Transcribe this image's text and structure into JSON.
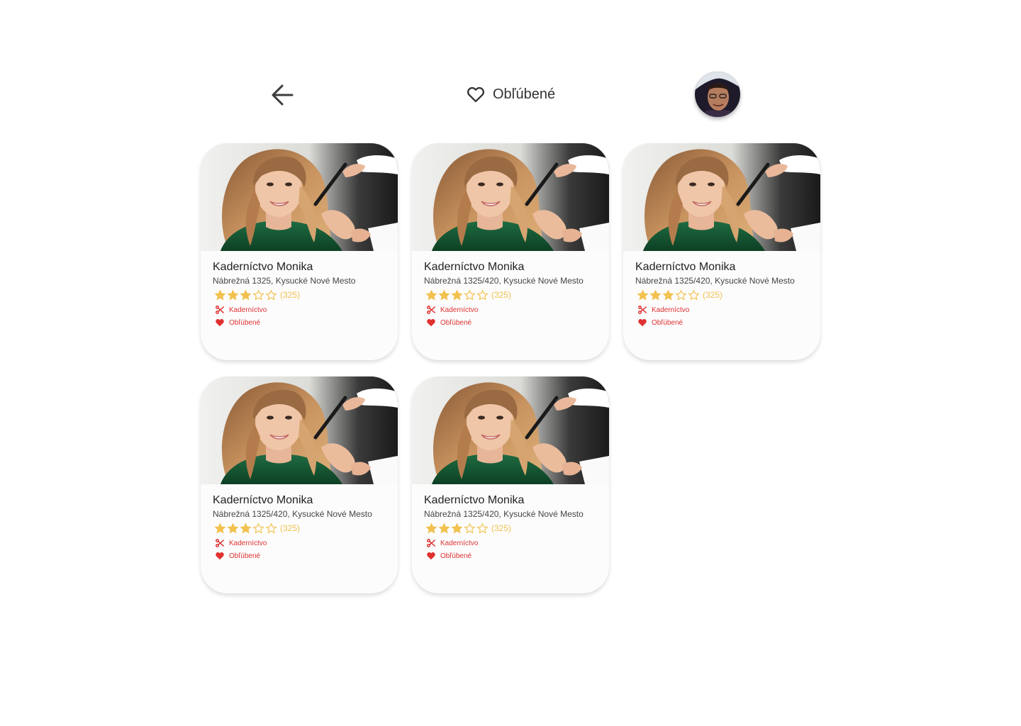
{
  "header": {
    "back_icon": "arrow-left-icon",
    "title_icon": "heart-outline-icon",
    "title": "Obľúbené",
    "avatar": "user-avatar"
  },
  "colors": {
    "star": "#f2c14e",
    "tag": "#e03131",
    "text": "#333333"
  },
  "cards": [
    {
      "name": "Kaderníctvo Monika",
      "address": "Nábrežná 1325, Kysucké Nové Mesto",
      "rating": 3,
      "rating_max": 5,
      "reviews": "(325)",
      "category": "Kaderníctvo",
      "favorite": "Obľúbené"
    },
    {
      "name": "Kaderníctvo Monika",
      "address": "Nábrežná 1325/420, Kysucké Nové Mesto",
      "rating": 3,
      "rating_max": 5,
      "reviews": "(325)",
      "category": "Kaderníctvo",
      "favorite": "Obľúbené"
    },
    {
      "name": "Kaderníctvo Monika",
      "address": "Nábrežná 1325/420, Kysucké Nové Mesto",
      "rating": 3,
      "rating_max": 5,
      "reviews": "(325)",
      "category": "Kaderníctvo",
      "favorite": "Obľúbené"
    },
    {
      "name": "Kaderníctvo Monika",
      "address": "Nábrežná 1325/420, Kysucké Nové Mesto",
      "rating": 3,
      "rating_max": 5,
      "reviews": "(325)",
      "category": "Kaderníctvo",
      "favorite": "Obľúbené"
    },
    {
      "name": "Kaderníctvo Monika",
      "address": "Nábrežná 1325/420, Kysucké Nové Mesto",
      "rating": 3,
      "rating_max": 5,
      "reviews": "(325)",
      "category": "Kaderníctvo",
      "favorite": "Obľúbené"
    }
  ]
}
